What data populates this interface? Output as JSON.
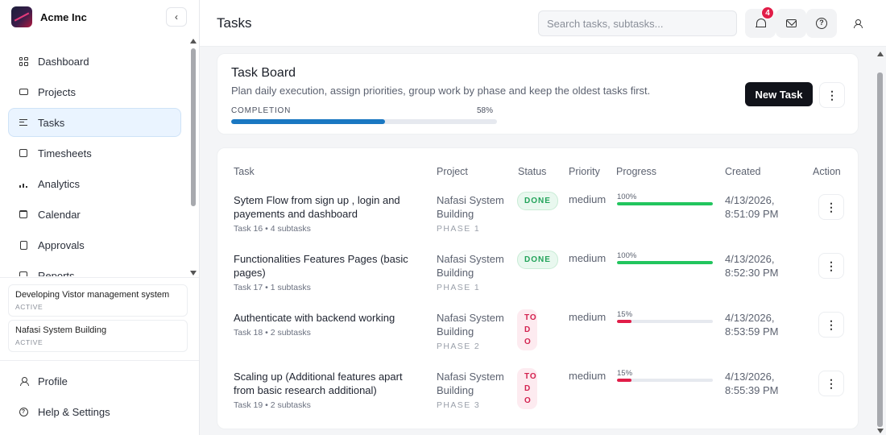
{
  "app": {
    "name": "Acme Inc",
    "collapse_label": "‹"
  },
  "sidebar": {
    "items": [
      {
        "label": "Dashboard",
        "icon": "dashboard-icon"
      },
      {
        "label": "Projects",
        "icon": "briefcase-icon"
      },
      {
        "label": "Tasks",
        "icon": "list-icon",
        "active": true
      },
      {
        "label": "Timesheets",
        "icon": "timesheet-icon"
      },
      {
        "label": "Analytics",
        "icon": "bar-chart-icon"
      },
      {
        "label": "Calendar",
        "icon": "calendar-icon"
      },
      {
        "label": "Approvals",
        "icon": "approvals-icon"
      },
      {
        "label": "Reports",
        "icon": "reports-icon"
      }
    ],
    "projects": [
      {
        "name": "Developing Vistor management system",
        "status": "ACTIVE"
      },
      {
        "name": "Nafasi System Building",
        "status": "ACTIVE"
      }
    ],
    "bottom": [
      {
        "label": "Profile",
        "icon": "user-icon"
      },
      {
        "label": "Help & Settings",
        "icon": "help-icon"
      }
    ]
  },
  "header": {
    "title": "Tasks",
    "search_placeholder": "Search tasks, subtasks...",
    "notification_count": "4"
  },
  "board": {
    "title": "Task Board",
    "subtitle": "Plan daily execution, assign priorities, group work by phase and keep the oldest tasks first.",
    "completion_label": "COMPLETION",
    "completion_pct": "58%",
    "completion_value": 58,
    "new_task_label": "New Task",
    "more_label": "⋮"
  },
  "table": {
    "columns": [
      "Task",
      "Project",
      "Status",
      "Priority",
      "Progress",
      "Created",
      "Action"
    ],
    "rows": [
      {
        "title": "Sytem Flow from sign up , login and payements and dashboard",
        "meta": "Task 16 • 4 subtasks",
        "project": "Nafasi System Building",
        "phase": "PHASE 1",
        "status": "DONE",
        "priority": "medium",
        "progress_label": "100%",
        "progress": 100,
        "created": "4/13/2026, 8:51:09 PM",
        "action": "⋮"
      },
      {
        "title": "Functionalities Features Pages (basic pages)",
        "meta": "Task 17 • 1 subtasks",
        "project": "Nafasi System Building",
        "phase": "PHASE 1",
        "status": "DONE",
        "priority": "medium",
        "progress_label": "100%",
        "progress": 100,
        "created": "4/13/2026, 8:52:30 PM",
        "action": "⋮"
      },
      {
        "title": "Authenticate with backend working",
        "meta": "Task 18 • 2 subtasks",
        "project": "Nafasi System Building",
        "phase": "PHASE 2",
        "status": "TO DO",
        "priority": "medium",
        "progress_label": "15%",
        "progress": 15,
        "created": "4/13/2026, 8:53:59 PM",
        "action": "⋮"
      },
      {
        "title": "Scaling up (Additional features apart from basic research additional)",
        "meta": "Task 19 • 2 subtasks",
        "project": "Nafasi System Building",
        "phase": "PHASE 3",
        "status": "TO DO",
        "priority": "medium",
        "progress_label": "15%",
        "progress": 15,
        "created": "4/13/2026, 8:55:39 PM",
        "action": "⋮"
      }
    ]
  },
  "colors": {
    "accent": "#1a78c2",
    "done": "#22c55e",
    "todo": "#e11d48",
    "primary_button": "#11131a"
  }
}
